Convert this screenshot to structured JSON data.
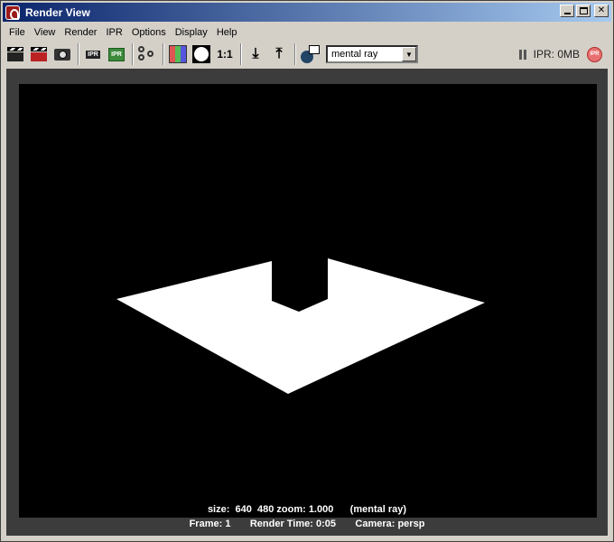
{
  "window": {
    "title": "Render View"
  },
  "menubar": {
    "items": [
      "File",
      "View",
      "Render",
      "IPR",
      "Options",
      "Display",
      "Help"
    ]
  },
  "toolbar": {
    "one_to_one_label": "1:1",
    "renderer_value": "mental ray",
    "ipr_memory": "IPR: 0MB",
    "ipr_stop_label": "IPR",
    "ipr_clapper_label": "IPR",
    "ipr_green_label": "IPR"
  },
  "render_info": {
    "size_line": "size:  640  480 zoom: 1.000      (mental ray)",
    "frame_line": "Frame: 1       Render Time: 0:05       Camera: persp"
  },
  "colors": {
    "background": "#d4d0c8",
    "render_bg": "#3c3c3c",
    "title_gradient_start": "#0a246a",
    "title_gradient_end": "#a6caf0"
  }
}
